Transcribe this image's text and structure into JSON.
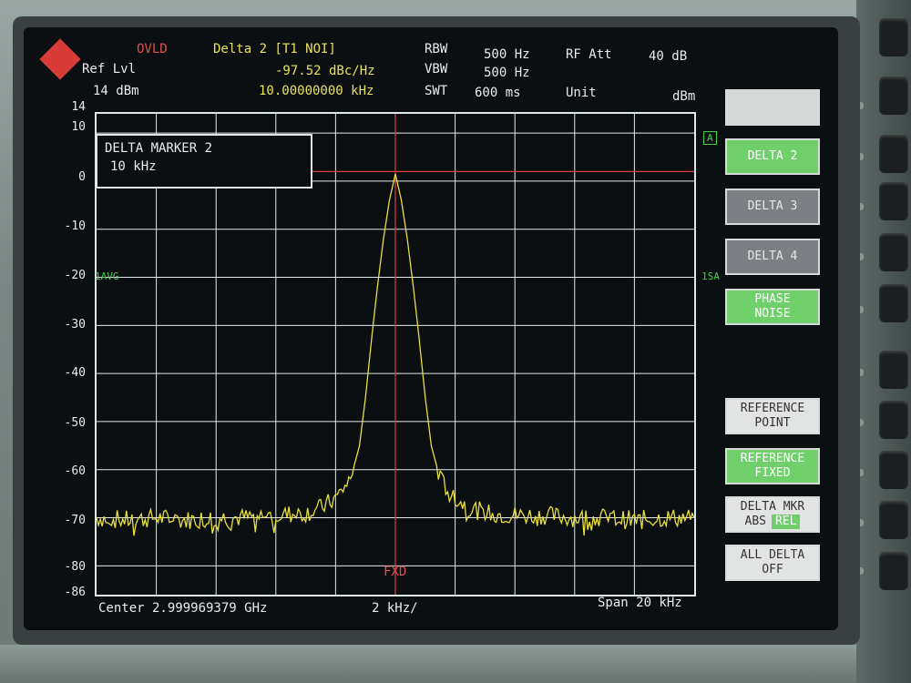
{
  "header": {
    "ovld": "OVLD",
    "ref_lvl_label": "Ref Lvl",
    "ref_lvl_value": "14 dBm",
    "marker_title": "Delta 2 [T1 NOI]",
    "marker_value_1": "-97.52 dBc/Hz",
    "marker_value_2": "10.00000000 kHz",
    "rbw_label": "RBW",
    "rbw_value": "500 Hz",
    "vbw_label": "VBW",
    "vbw_value": "500 Hz",
    "swt_label": "SWT",
    "swt_value": "600 ms",
    "rf_att_label": "RF Att",
    "rf_att_value": "40 dB",
    "unit_label": "Unit",
    "unit_value": "dBm"
  },
  "marker_box": {
    "title": "DELTA MARKER 2",
    "value": "10 kHz"
  },
  "plot_labels": {
    "trace_a": "A",
    "avg_left": "1AVG",
    "sa_right": "1SA",
    "fxd": "FXD"
  },
  "footer": {
    "center": "Center 2.999969379 GHz",
    "div": "2 kHz/",
    "span": "Span 20 kHz"
  },
  "softkeys": {
    "blank": "",
    "delta2": "DELTA 2",
    "delta3": "DELTA 3",
    "delta4": "DELTA 4",
    "phase_noise_1": "PHASE",
    "phase_noise_2": "NOISE",
    "ref_point_1": "REFERENCE",
    "ref_point_2": "POINT",
    "ref_fixed_1": "REFERENCE",
    "ref_fixed_2": "FIXED",
    "delta_mkr_1": "DELTA MKR",
    "delta_mkr_abs": "ABS",
    "delta_mkr_rel": "REL",
    "all_delta_1": "ALL DELTA",
    "all_delta_2": "OFF"
  },
  "colors": {
    "trace": "#e8df3a",
    "grid": "#dfe8e8",
    "reference_line": "#d94040",
    "accent_green": "#6fd06b"
  },
  "chart_data": {
    "type": "line",
    "ylim": [
      -86,
      14
    ],
    "yticks": [
      14,
      10,
      0,
      -10,
      -20,
      -30,
      -40,
      -50,
      -60,
      -70,
      -80,
      -86
    ],
    "xlim": [
      -10,
      10
    ],
    "x_unit": "kHz offset from center",
    "reference_level": 2,
    "series": [
      {
        "x": [
          -10,
          -9,
          -8,
          -7,
          -6,
          -5,
          -4,
          -3,
          -2.5,
          -2,
          -1.5,
          -1.2,
          -1,
          -0.8,
          -0.6,
          -0.4,
          -0.2,
          0,
          0.2,
          0.4,
          0.6,
          0.8,
          1,
          1.2,
          1.5,
          2,
          2.5,
          3,
          4,
          5,
          6,
          7,
          8,
          9,
          10
        ],
        "y": [
          -70,
          -70.5,
          -70,
          -70.5,
          -70,
          -70,
          -69.5,
          -69,
          -68,
          -66,
          -62,
          -55,
          -45,
          -33,
          -22,
          -12,
          -4,
          1.5,
          -4,
          -12,
          -22,
          -33,
          -45,
          -55,
          -62,
          -66,
          -68,
          -69,
          -69.5,
          -69.5,
          -70,
          -70,
          -70.5,
          -70,
          -70
        ]
      }
    ]
  }
}
